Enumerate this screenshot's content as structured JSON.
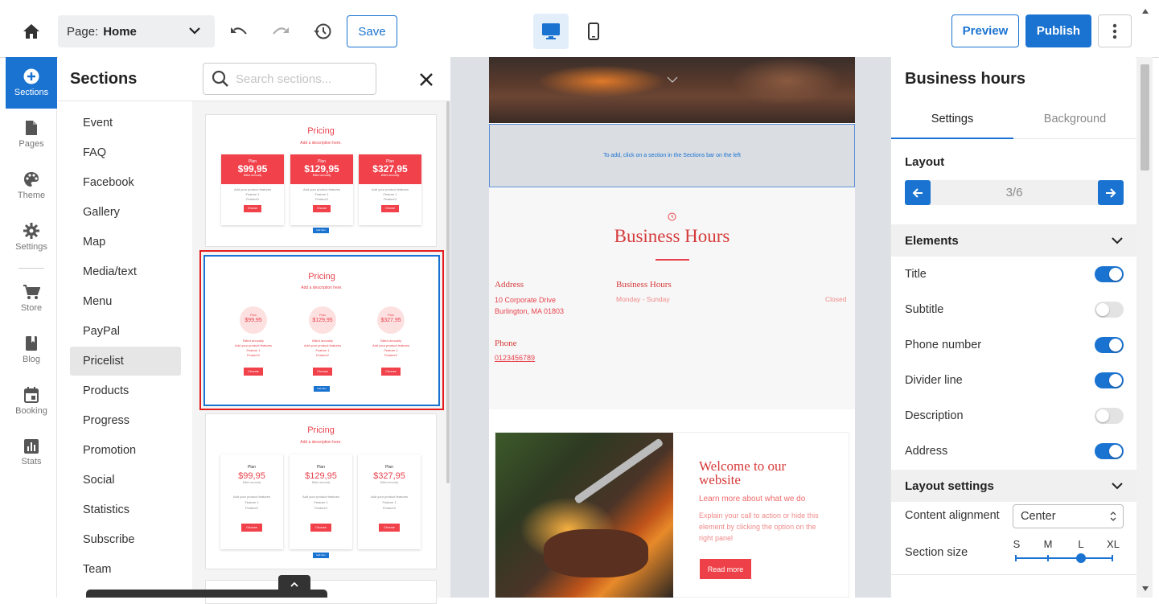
{
  "topbar": {
    "page_label": "Page:",
    "page_value": "Home",
    "save_label": "Save",
    "preview_label": "Preview",
    "publish_label": "Publish"
  },
  "rail": [
    {
      "label": "Sections",
      "icon": "plus-circle-icon",
      "active": true
    },
    {
      "label": "Pages",
      "icon": "page-icon"
    },
    {
      "label": "Theme",
      "icon": "palette-icon"
    },
    {
      "label": "Settings",
      "icon": "gear-icon"
    },
    {
      "label": "Store",
      "icon": "cart-icon"
    },
    {
      "label": "Blog",
      "icon": "book-icon"
    },
    {
      "label": "Booking",
      "icon": "calendar-icon"
    },
    {
      "label": "Stats",
      "icon": "bar-chart-icon"
    }
  ],
  "sections_panel": {
    "title": "Sections",
    "search_placeholder": "Search sections...",
    "categories": [
      "Event",
      "FAQ",
      "Facebook",
      "Gallery",
      "Map",
      "Media/text",
      "Menu",
      "PayPal",
      "Pricelist",
      "Products",
      "Progress",
      "Promotion",
      "Social",
      "Statistics",
      "Subscribe",
      "Team"
    ],
    "active_category": "Pricelist"
  },
  "thumbs": {
    "title": "Pricing",
    "desc": "Add a description here.",
    "plan": "Plan",
    "billed": "Billed annually",
    "features": [
      "Add your product features",
      "Feature 1",
      "Feature2"
    ],
    "choose": "Choose",
    "add_item": "Add Item",
    "prices": [
      "$99,95",
      "$129,95",
      "$327,95"
    ]
  },
  "site": {
    "drop_hint": "To add, click on a section in the Sections bar on the left",
    "bh_title": "Business Hours",
    "address_label": "Address",
    "address_line1": "10 Corporate Drive",
    "address_line2": "Burlington, MA 01803",
    "hours_label": "Business Hours",
    "hours_days": "Monday - Sunday",
    "hours_status": "Closed",
    "phone_label": "Phone",
    "phone_value": "0123456789",
    "welcome_title": "Welcome to our website",
    "welcome_sub": "Learn more about what we do",
    "welcome_desc": "Explain your call to action or hide this element by clicking the option on the right panel",
    "read_more": "Read more"
  },
  "right_panel": {
    "title": "Business hours",
    "tab_settings": "Settings",
    "tab_background": "Background",
    "layout_label": "Layout",
    "layout_value": "3/6",
    "elements_header": "Elements",
    "elements": [
      {
        "label": "Title",
        "on": true
      },
      {
        "label": "Subtitle",
        "on": false
      },
      {
        "label": "Phone number",
        "on": true
      },
      {
        "label": "Divider line",
        "on": true
      },
      {
        "label": "Description",
        "on": false
      },
      {
        "label": "Address",
        "on": true
      }
    ],
    "layout_settings_header": "Layout settings",
    "content_alignment_label": "Content alignment",
    "content_alignment_value": "Center",
    "section_size_label": "Section size",
    "section_sizes": [
      "S",
      "M",
      "L",
      "XL"
    ],
    "section_size_selected": "L"
  },
  "colors": {
    "accent": "#1a73d1",
    "brand_red": "#e8434d",
    "selection_red": "#e31d1d"
  }
}
